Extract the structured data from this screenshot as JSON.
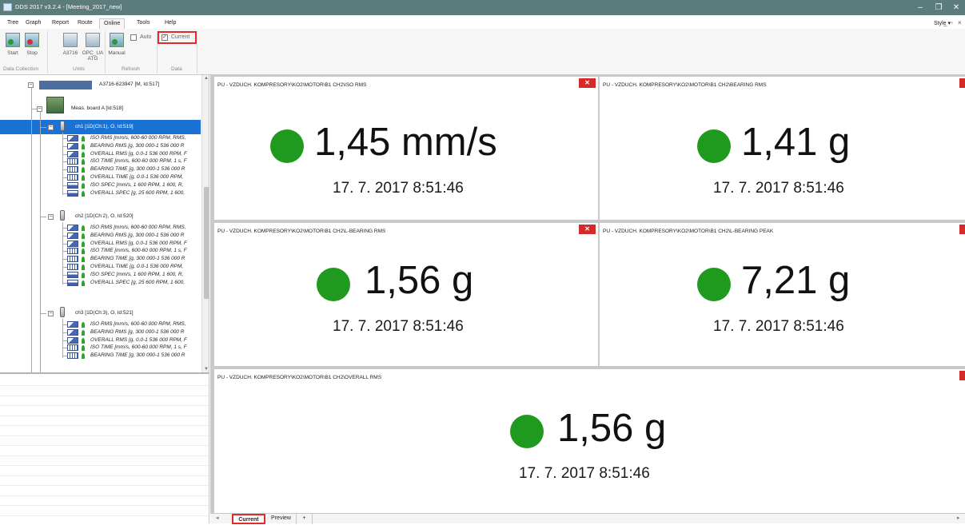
{
  "window": {
    "title": "DDS 2017 v3.2.4 - [Meeting_2017_new]",
    "controls": [
      "–",
      "❐",
      "✕"
    ]
  },
  "menu": {
    "items": [
      "Tree",
      "Graph",
      "Report",
      "Route",
      "Online",
      "Tools",
      "Help"
    ],
    "active": "Online",
    "style_label": "Style",
    "mdi_controls": [
      "_",
      "▫",
      "×"
    ]
  },
  "ribbon": {
    "start_label": "Start",
    "stop_label": "Stop",
    "a3716_label": "A3716",
    "opc_label_1": "OPC_UA",
    "opc_label_2": "ATG",
    "manual_label": "Manual",
    "auto_label": "Auto",
    "auto_checked": false,
    "current_label": "Current",
    "current_checked": true,
    "groups": [
      "Data Collection",
      "Units",
      "Refresh",
      "Data"
    ]
  },
  "tree": {
    "device": "A3716-623947 [M, Id:517]",
    "board": "Meas. board A [Id:518]",
    "channels": [
      {
        "label": "ch1 [1D(Ch:1), O, Id:519]",
        "selected": true,
        "leaves": [
          "ISO RMS [mm/s, 600-60 000 RPM, RMS,",
          "BEARING RMS [g, 300 000-1 536 000 R",
          "OVERALL RMS [g, 0.0-1 536 000 RPM, F",
          "ISO TIME [mm/s, 600-60 000 RPM, 1 s, F",
          "BEARING TIME [g, 300 000-1 536 000 R",
          "OVERALL TIME [g, 0.0-1 536 000 RPM,",
          "ISO SPEC [mm/s, 1 600 RPM, 1 600, R,",
          "OVERALL SPEC [g, 25 600 RPM, 1 600,"
        ]
      },
      {
        "label": "ch2 [1D(Ch:2), O, Id:520]",
        "selected": false,
        "leaves": [
          "ISO RMS [mm/s, 600-60 000 RPM, RMS,",
          "BEARING RMS [g, 300 000-1 536 000 R",
          "OVERALL RMS [g, 0.0-1 536 000 RPM, F",
          "ISO TIME [mm/s, 600-60 000 RPM, 1 s, F",
          "BEARING TIME [g, 300 000-1 536 000 R",
          "OVERALL TIME [g, 0.0-1 536 000 RPM,",
          "ISO SPEC [mm/s, 1 600 RPM, 1 600, R,",
          "OVERALL SPEC [g, 25 600 RPM, 1 600,"
        ]
      },
      {
        "label": "ch3 [1D(Ch:3), O, Id:521]",
        "selected": false,
        "leaves": [
          "ISO RMS [mm/s, 600-60 000 RPM, RMS,",
          "BEARING RMS [g, 300 000-1 536 000 R",
          "OVERALL RMS [g, 0.0-1 536 000 RPM, F",
          "ISO TIME [mm/s, 600-60 000 RPM, 1 s, F",
          "BEARING TIME [g, 300 000-1 536 000 R"
        ]
      }
    ]
  },
  "panels": [
    {
      "title": "PU - VZDUCH. KOMPRESORY\\KO2\\MOTOR\\B1 CH2\\ISO RMS",
      "value": "1,45 mm/s",
      "time": "17. 7. 2017 8:51:46",
      "status_color": "#1f9a1f"
    },
    {
      "title": "PU - VZDUCH. KOMPRESORY\\KO2\\MOTOR\\B1 CH2\\BEARING RMS",
      "value": "1,41 g",
      "time": "17. 7. 2017 8:51:46",
      "status_color": "#1f9a1f"
    },
    {
      "title": "PU - VZDUCH. KOMPRESORY\\KO2\\MOTOR\\B1 CH2\\L-BEARING RMS",
      "value": "1,56 g",
      "time": "17. 7. 2017 8:51:46",
      "status_color": "#1f9a1f"
    },
    {
      "title": "PU - VZDUCH. KOMPRESORY\\KO2\\MOTOR\\B1 CH2\\L-BEARING PEAK",
      "value": "7,21 g",
      "time": "17. 7. 2017 8:51:46",
      "status_color": "#1f9a1f"
    },
    {
      "title": "PU - VZDUCH. KOMPRESORY\\KO2\\MOTOR\\B1 CH2\\OVERALL RMS",
      "value": "1,56 g",
      "time": "17. 7. 2017 8:51:46",
      "status_color": "#1f9a1f"
    }
  ],
  "tabs": {
    "items": [
      "Current",
      "Preview",
      "+"
    ],
    "active": "Current"
  },
  "colors": {
    "titlebar": "#5c7b7b",
    "selection": "#1a73d4",
    "close_red": "#d52a2a",
    "status_green": "#1f9a1f",
    "highlight_red": "#e02b2b"
  }
}
